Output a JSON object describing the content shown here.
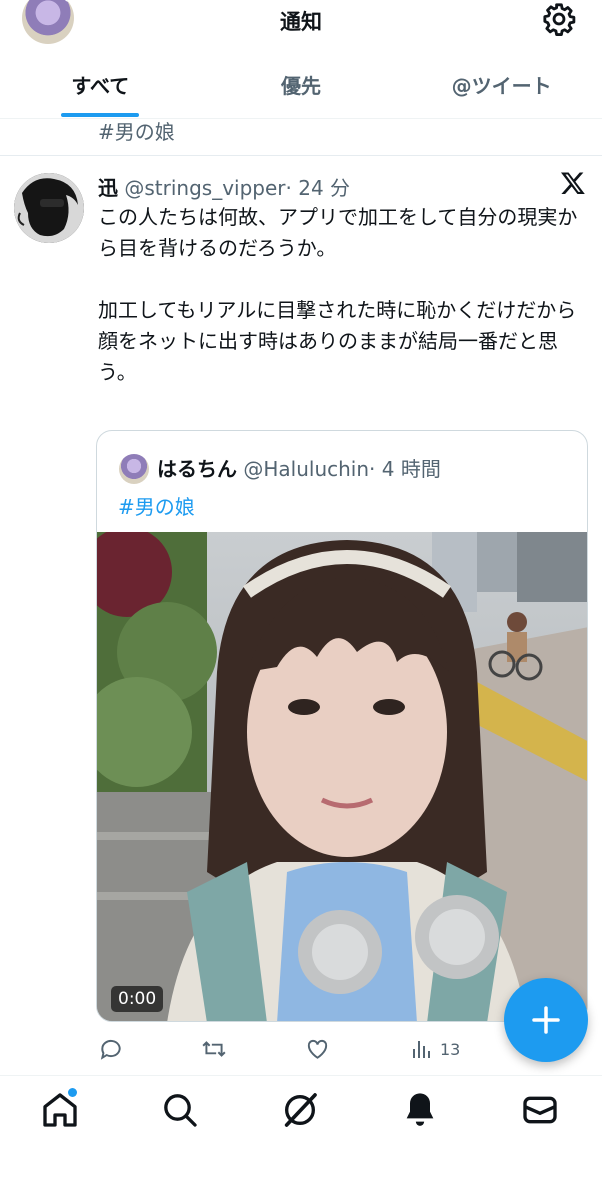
{
  "header": {
    "title": "通知"
  },
  "tabs": [
    {
      "label": "すべて",
      "active": true
    },
    {
      "label": "優先",
      "active": false
    },
    {
      "label": "@ツイート",
      "active": false
    }
  ],
  "previous_tweet": {
    "hashtag": "#男の娘"
  },
  "tweet": {
    "name": "迅",
    "handle": "@strings_vipper",
    "time": "· 24 分",
    "text": "この人たちは何故、アプリで加工をして自分の現実から目を背けるのだろうか。\n\n加工してもリアルに目撃された時に恥かくだけだから\n顔をネットに出す時はありのままが結局一番だと思う。",
    "quote": {
      "name": "はるちん",
      "handle": "@Haluluchin",
      "time": "· 4 時間",
      "hashtag": "#男の娘",
      "video_duration": "0:00"
    },
    "stats": {
      "views": "13"
    }
  },
  "icons": {
    "settings": "gear-icon",
    "platform": "x-logo-icon",
    "compose": "plus-icon",
    "reply": "reply-icon",
    "retweet": "retweet-icon",
    "like": "heart-icon",
    "views": "bar-chart-icon",
    "nav": [
      "home-icon",
      "search-icon",
      "grok-icon",
      "bell-icon",
      "mail-icon"
    ]
  },
  "colors": {
    "accent": "#1d9bf0",
    "text_primary": "#0f1419",
    "text_secondary": "#536471",
    "border": "#cfd9de"
  }
}
